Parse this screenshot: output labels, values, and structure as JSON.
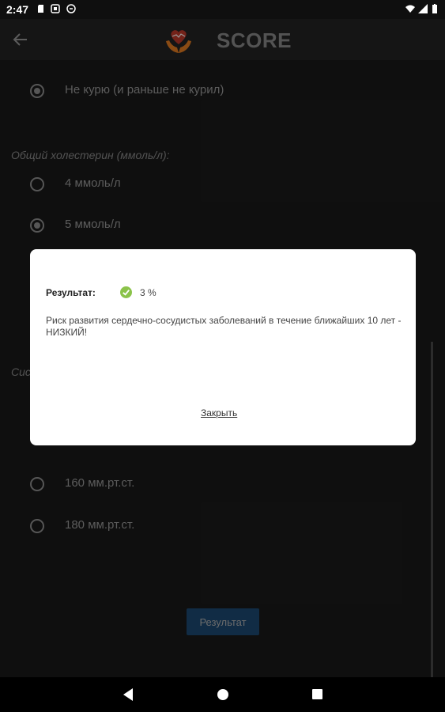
{
  "status_bar": {
    "time": "2:47"
  },
  "app_bar": {
    "title": "SCORE"
  },
  "form": {
    "smoking_option": "Не курю (и раньше не курил)",
    "cholesterol_label": "Общий холестерин (ммоль/л):",
    "cholesterol_options": [
      "4 ммоль/л",
      "5 ммоль/л"
    ],
    "pressure_label_partial": "Сис",
    "pressure_options": [
      "160 мм.рт.ст.",
      "180 мм.рт.ст."
    ],
    "result_button": "Результат"
  },
  "dialog": {
    "result_label": "Результат:",
    "result_value": "3 %",
    "message": "Риск развития сердечно-сосудистых заболеваний в течение ближайших 10 лет - НИЗКИЙ!",
    "close_label": "Закрыть"
  },
  "colors": {
    "accent_button": "#1d4a73",
    "check_green": "#8bc34a",
    "logo_heart": "#c0392b",
    "logo_hands": "#e67e22"
  }
}
